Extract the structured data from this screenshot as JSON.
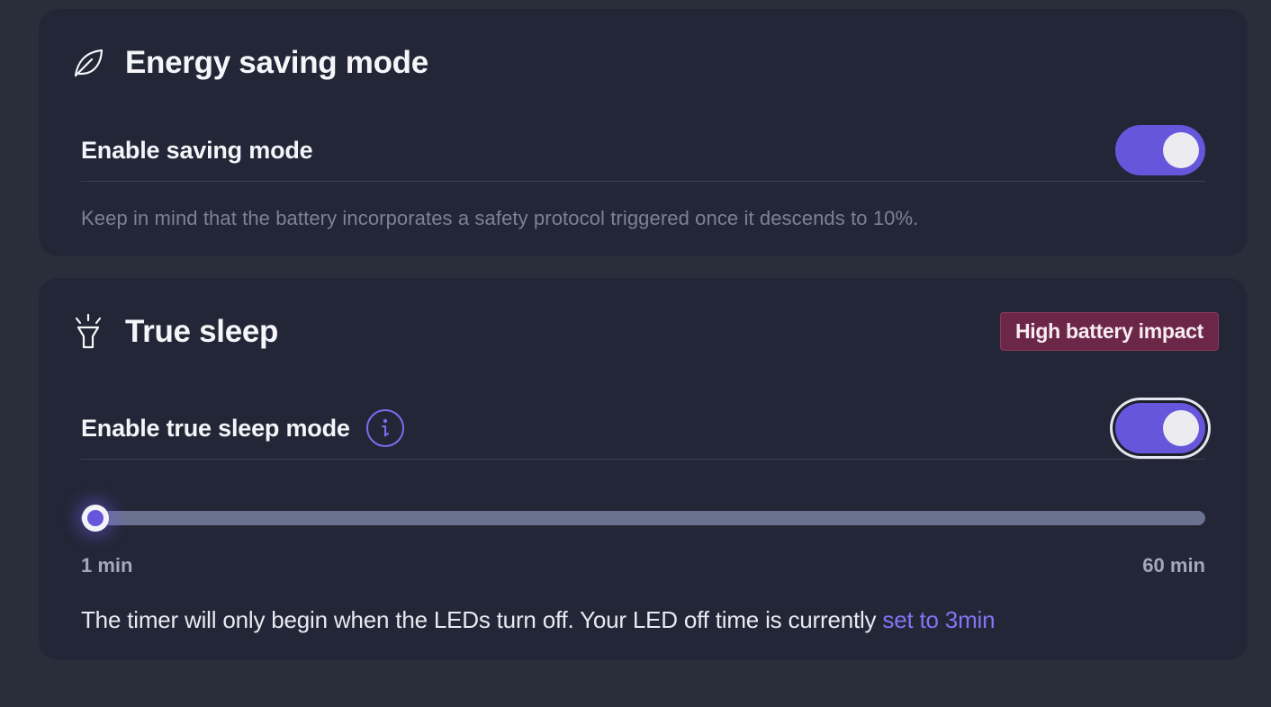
{
  "energy": {
    "icon": "leaf-icon",
    "title": "Energy saving mode",
    "enable_label": "Enable saving mode",
    "enabled": true,
    "hint": "Keep in mind that the battery incorporates a safety protocol triggered once it descends to 10%."
  },
  "sleep": {
    "icon": "flashlight-icon",
    "title": "True sleep",
    "badge": "High battery impact",
    "enable_label": "Enable true sleep mode",
    "info_icon": "info-icon",
    "enabled": true,
    "slider": {
      "min_label": "1 min",
      "max_label": "60 min",
      "min": 1,
      "max": 60,
      "value": 1
    },
    "footer_text": "The timer will only begin when the LEDs turn off. Your LED off time is currently ",
    "footer_link": "set to 3min"
  },
  "colors": {
    "page_bg": "#2a2e3b",
    "card_bg": "#232636",
    "accent": "#6656dc",
    "link": "#8275f4",
    "badge_bg": "#6c2748",
    "muted_text": "#7d8196"
  }
}
